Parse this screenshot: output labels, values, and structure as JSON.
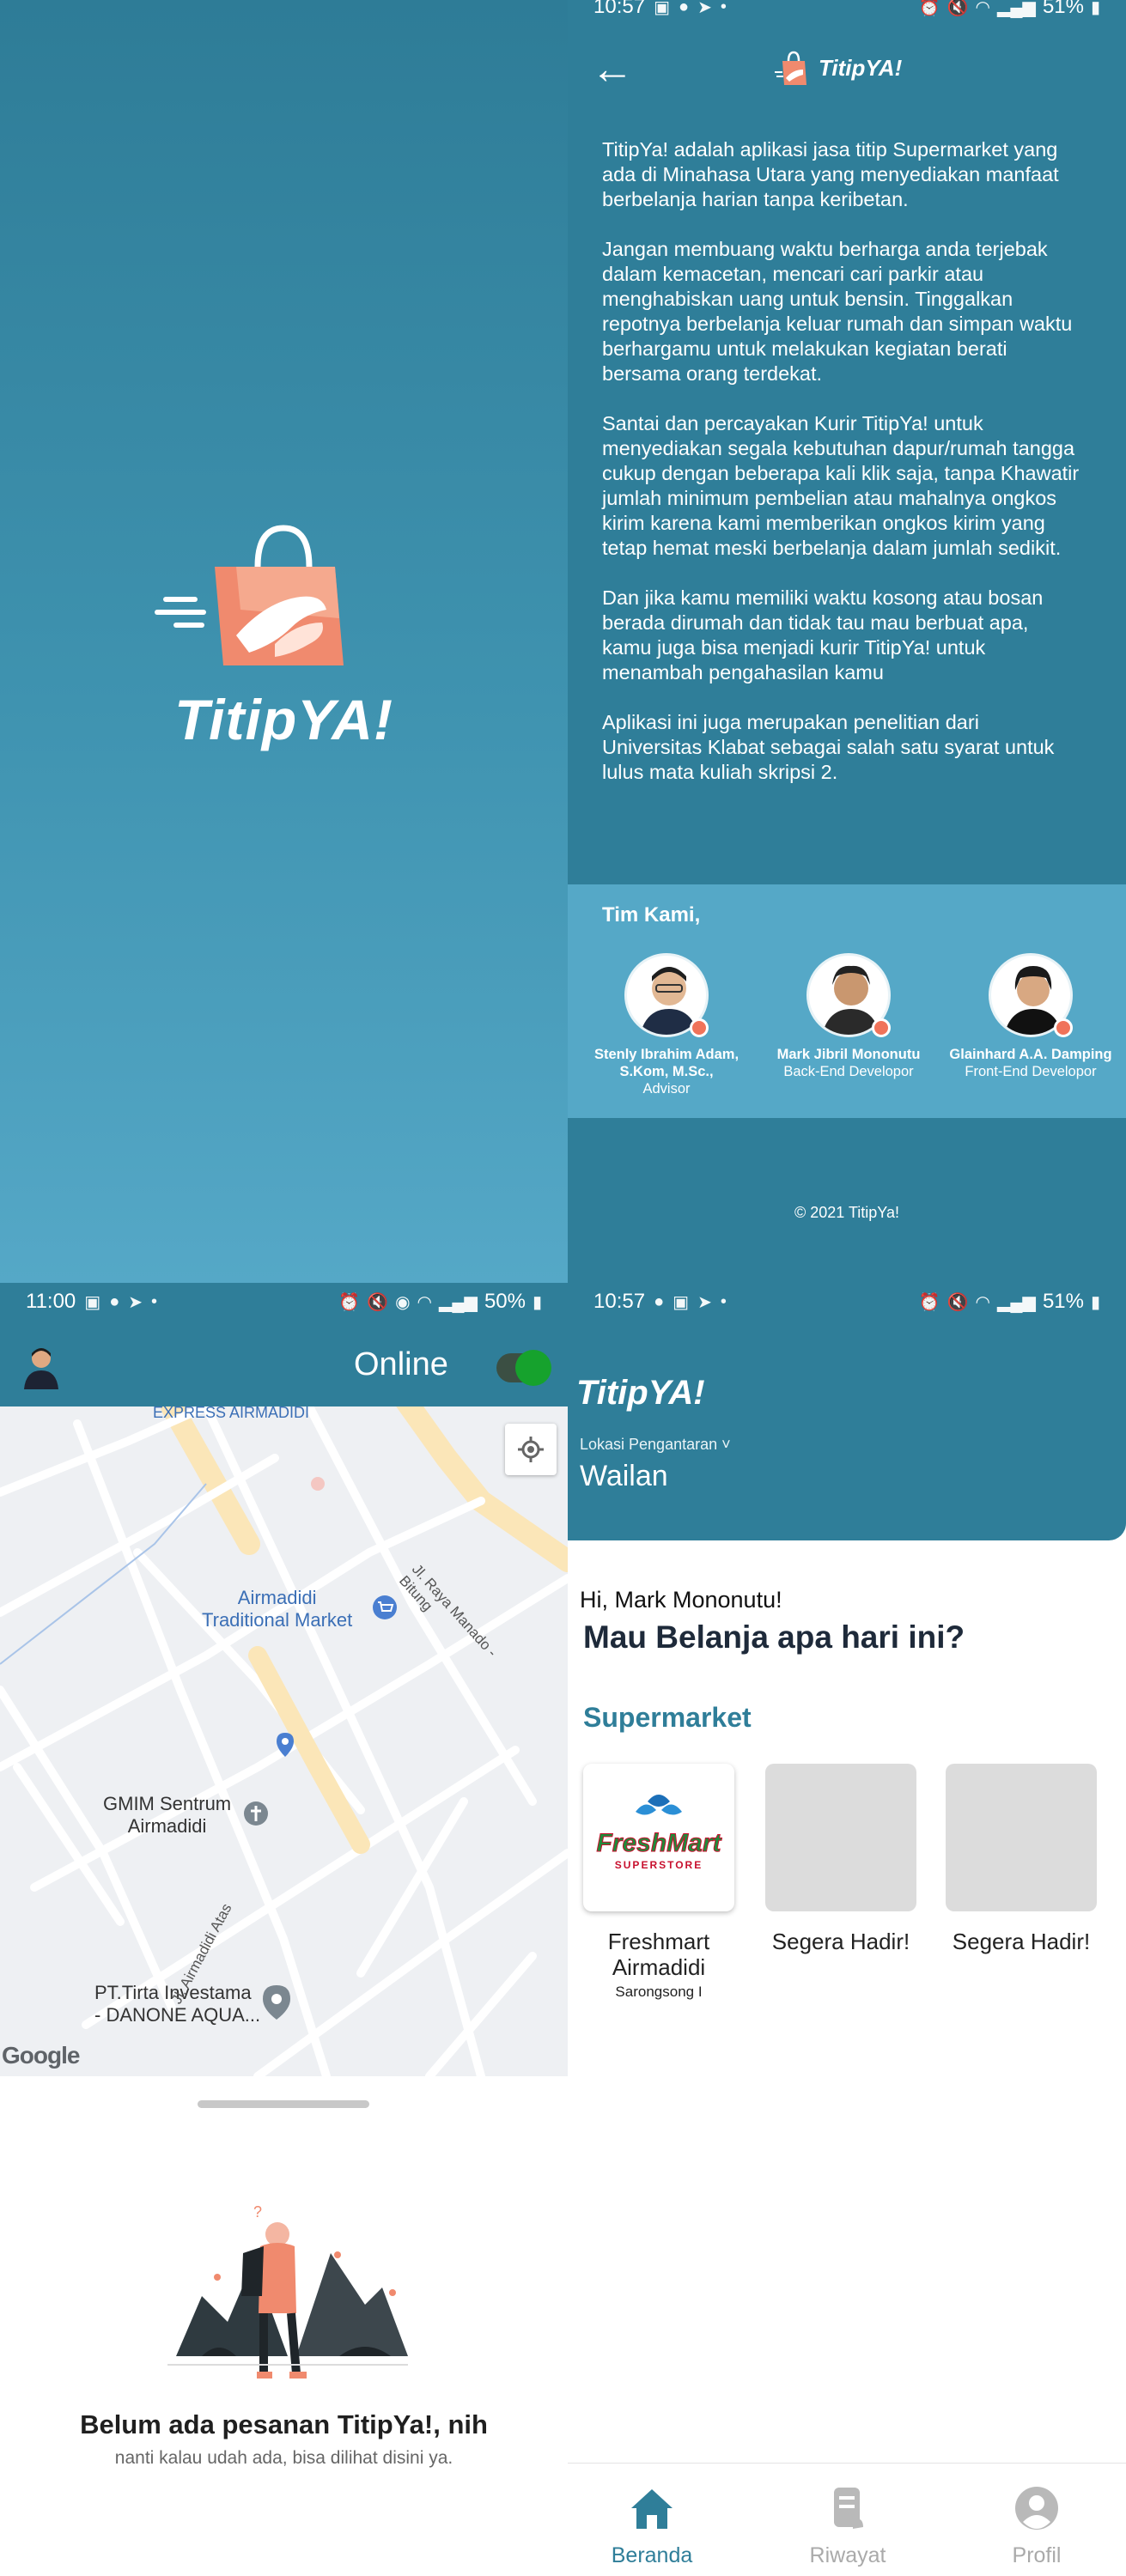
{
  "colors": {
    "primary": "#2f7e99",
    "team_background": "#55a8c7",
    "accent_orange": "#f0735a",
    "online_green": "#16a22d"
  },
  "splash": {
    "brand": "TitipYA!"
  },
  "about": {
    "status": {
      "time": "10:57",
      "left_icons": [
        "image-icon",
        "facebook-icon",
        "telegram-icon",
        "dot-icon"
      ],
      "battery": "51%"
    },
    "brand": "TitipYA!",
    "paragraphs": [
      "TitipYa! adalah aplikasi jasa titip Supermarket yang ada di Minahasa Utara yang menyediakan manfaat berbelanja harian tanpa keribetan.",
      "Jangan membuang waktu berharga anda terjebak dalam kemacetan, mencari cari parkir atau menghabiskan uang untuk bensin. Tinggalkan repotnya berbelanja keluar rumah dan simpan waktu berhargamu untuk melakukan kegiatan berati bersama orang terdekat.",
      "Santai dan percayakan Kurir TitipYa! untuk menyediakan segala kebutuhan dapur/rumah tangga cukup dengan beberapa kali klik saja, tanpa Khawatir jumlah minimum pembelian atau mahalnya ongkos kirim karena kami memberikan ongkos kirim yang tetap hemat meski berbelanja dalam jumlah sedikit.",
      "Dan jika kamu memiliki waktu kosong atau bosan berada dirumah dan tidak tau mau berbuat apa, kamu juga bisa menjadi kurir TitipYa! untuk menambah pengahasilan kamu",
      "Aplikasi ini juga merupakan penelitian dari Universitas Klabat sebagai salah satu syarat untuk lulus mata kuliah skripsi 2."
    ],
    "team_title": "Tim Kami,",
    "members": [
      {
        "name": "Stenly Ibrahim Adam, S.Kom, M.Sc.,",
        "role": "Advisor"
      },
      {
        "name": "Mark Jibril Mononutu",
        "role": "Back-End Developor"
      },
      {
        "name": "Glainhard A.A. Damping",
        "role": "Front-End Developor"
      }
    ],
    "copyright": "© 2021 TitipYa!"
  },
  "driver": {
    "status": {
      "time": "11:00",
      "left_icons": [
        "image-icon",
        "facebook-icon",
        "telegram-icon",
        "dot-icon"
      ],
      "battery": "50%"
    },
    "online_label": "Online",
    "online": true,
    "map": {
      "labels": {
        "top_cut": "EXPRESS AIRMADIDI",
        "market": "Airmadidi\nTraditional Market",
        "church": "GMIM Sentrum\nAirmadidi",
        "factory": "PT.Tirta Investama\n- DANONE AQUA...",
        "road_1": "Jl. Raya Manado - Bitung",
        "road_2": "Jl. Airmadidi Atas"
      },
      "attribution": "Google"
    },
    "empty_title": "Belum ada pesanan TitipYa!, nih",
    "empty_subtitle": "nanti kalau udah ada, bisa dilihat disini ya."
  },
  "home": {
    "status": {
      "time": "10:57",
      "left_icons": [
        "facebook-icon",
        "image-icon",
        "telegram-icon",
        "dot-icon"
      ],
      "battery": "51%"
    },
    "brand": "TitipYA!",
    "location_caption": "Lokasi Pengantaran",
    "location_value": "Wailan",
    "greeting": "Hi, Mark Mononutu!",
    "headline": "Mau Belanja apa hari ini?",
    "section_title": "Supermarket",
    "stores": [
      {
        "name": "Freshmart Airmadidi",
        "subtitle": "Sarongsong I",
        "logo_text": "FreshMart",
        "logo_sub": "SUPERSTORE"
      },
      {
        "name": "Segera Hadir!",
        "subtitle": ""
      },
      {
        "name": "Segera Hadir!",
        "subtitle": ""
      }
    ],
    "nav": [
      {
        "label": "Beranda",
        "icon": "home-icon",
        "active": true
      },
      {
        "label": "Riwayat",
        "icon": "receipt-icon",
        "active": false
      },
      {
        "label": "Profil",
        "icon": "profile-icon",
        "active": false
      }
    ]
  }
}
